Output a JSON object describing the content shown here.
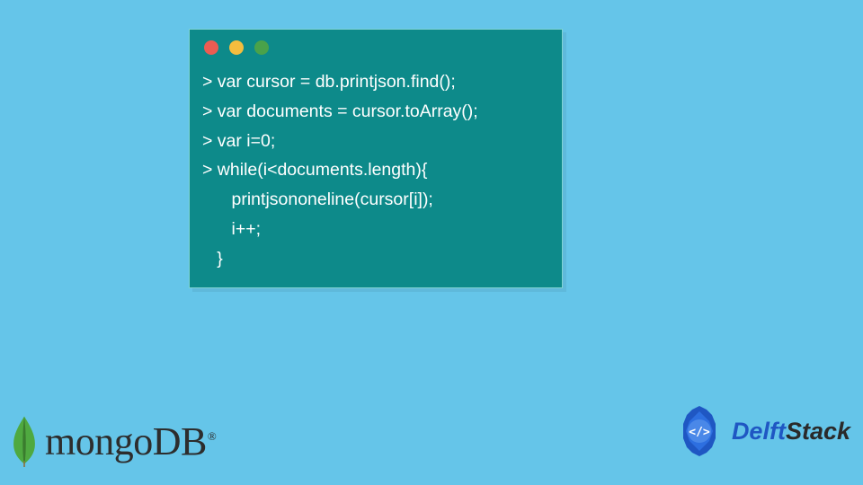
{
  "terminal": {
    "dots": [
      "red",
      "yellow",
      "green"
    ],
    "lines": [
      "> var cursor = db.printjson.find();",
      "> var documents = cursor.toArray();",
      "> var i=0;",
      "> while(i<documents.length){",
      "      printjsononeline(cursor[i]);",
      "      i++;",
      "   }"
    ]
  },
  "mongo": {
    "text": "mongoDB",
    "reg": "®"
  },
  "delft": {
    "text1": "Delft",
    "text2": "Stack",
    "badge_glyph": "</>"
  }
}
